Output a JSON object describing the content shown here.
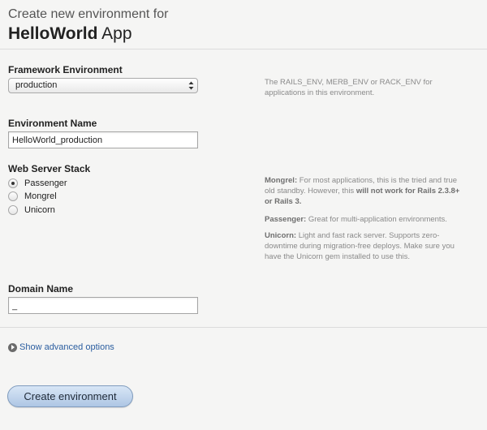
{
  "header": {
    "subtitle": "Create new environment for",
    "app_name": "HelloWorld",
    "app_suffix": "App"
  },
  "framework": {
    "label": "Framework Environment",
    "selected": "production",
    "help": "The RAILS_ENV, MERB_ENV or RACK_ENV for applications in this environment."
  },
  "env_name": {
    "label": "Environment Name",
    "value": "HelloWorld_production"
  },
  "stack": {
    "label": "Web Server Stack",
    "options": [
      {
        "label": "Passenger",
        "checked": true
      },
      {
        "label": "Mongrel",
        "checked": false
      },
      {
        "label": "Unicorn",
        "checked": false
      }
    ],
    "help": {
      "mongrel_title": "Mongrel:",
      "mongrel_text": "For most applications, this is the tried and true old standby. However, this",
      "mongrel_warning": "will not work for Rails 2.3.8+ or Rails 3.",
      "passenger_title": "Passenger:",
      "passenger_text": "Great for multi-application environments.",
      "unicorn_title": "Unicorn:",
      "unicorn_text": "Light and fast rack server. Supports zero-downtime during migration-free deploys. Make sure you have the Unicorn gem installed to use this."
    }
  },
  "domain": {
    "label": "Domain Name",
    "value": "_"
  },
  "advanced": {
    "label": "Show advanced options",
    "icon": "expand-arrow-icon"
  },
  "submit": {
    "label": "Create environment"
  }
}
